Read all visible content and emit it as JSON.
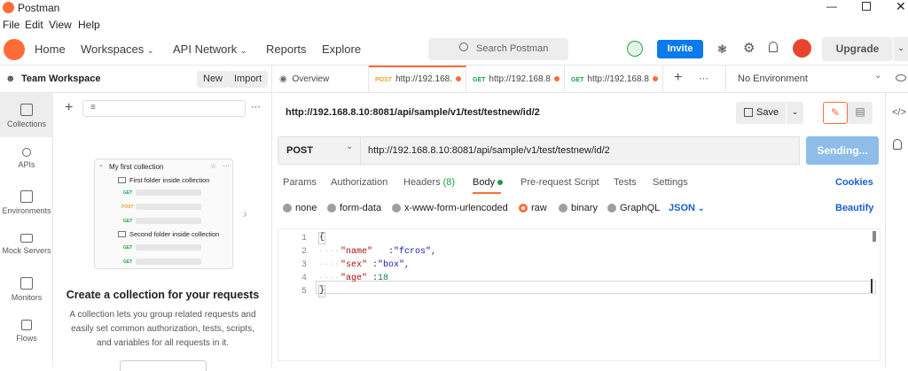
{
  "window": {
    "title": "Postman",
    "controls": [
      "minimize",
      "maximize",
      "close"
    ]
  },
  "menu": [
    "File",
    "Edit",
    "View",
    "Help"
  ],
  "header": {
    "home": "Home",
    "workspaces": "Workspaces",
    "api_network": "API Network",
    "reports": "Reports",
    "explore": "Explore",
    "search_placeholder": "Search Postman",
    "invite": "Invite",
    "upgrade": "Upgrade"
  },
  "workspace": {
    "name": "Team Workspace",
    "new_label": "New",
    "import_label": "Import"
  },
  "sidebar": {
    "items": [
      {
        "label": "Collections",
        "icon": "collections-icon"
      },
      {
        "label": "APIs",
        "icon": "apis-icon"
      },
      {
        "label": "Environments",
        "icon": "environments-icon"
      },
      {
        "label": "Mock Servers",
        "icon": "mock-servers-icon"
      },
      {
        "label": "Monitors",
        "icon": "monitors-icon"
      },
      {
        "label": "Flows",
        "icon": "flows-icon"
      }
    ]
  },
  "empty_state": {
    "collection_name": "My first collection",
    "folder1": "First folder inside collection",
    "folder2": "Second folder inside collection",
    "title": "Create a collection for your requests",
    "text1": "A collection lets you group related requests and",
    "text2": "easily set common authorization, tests, scripts,",
    "text3": "and variables for all requests in it."
  },
  "tabs": {
    "overview": "Overview",
    "tab1_method": "POST",
    "tab1_url": "http://192.168.",
    "tab2_method": "GET",
    "tab2_url": "http://192.168.8",
    "tab3_method": "GET",
    "tab3_url": "http://192.168.8",
    "environment": "No Environment"
  },
  "request": {
    "title": "http://192.168.8.10:8081/api/sample/v1/test/testnew/id/2",
    "save": "Save",
    "method": "POST",
    "url": "http://192.168.8.10:8081/api/sample/v1/test/testnew/id/2",
    "send": "Sending..."
  },
  "req_tabs": {
    "params": "Params",
    "authorization": "Authorization",
    "headers": "Headers",
    "headers_count": "(8)",
    "body": "Body",
    "prerequest": "Pre-request Script",
    "tests": "Tests",
    "settings": "Settings",
    "cookies": "Cookies"
  },
  "body_types": {
    "none": "none",
    "form_data": "form-data",
    "urlencoded": "x-www-form-urlencoded",
    "raw": "raw",
    "binary": "binary",
    "graphql": "GraphQL",
    "json": "JSON",
    "beautify": "Beautify"
  },
  "code": {
    "lines": [
      {
        "n": "1",
        "text": "{"
      },
      {
        "n": "2",
        "key": "\"name\"",
        "val": "\"fcros\","
      },
      {
        "n": "3",
        "key": "\"sex\"",
        "val": "\"box\","
      },
      {
        "n": "4",
        "key": "\"age\"",
        "val": "18"
      },
      {
        "n": "5",
        "text": "}"
      }
    ]
  },
  "colors": {
    "accent": "#ff6c37",
    "invite": "#097bed",
    "send": "#8dbde8",
    "json": "#1a5fc9",
    "key": "#a11",
    "string": "#1a1aa6",
    "number": "#098658"
  }
}
